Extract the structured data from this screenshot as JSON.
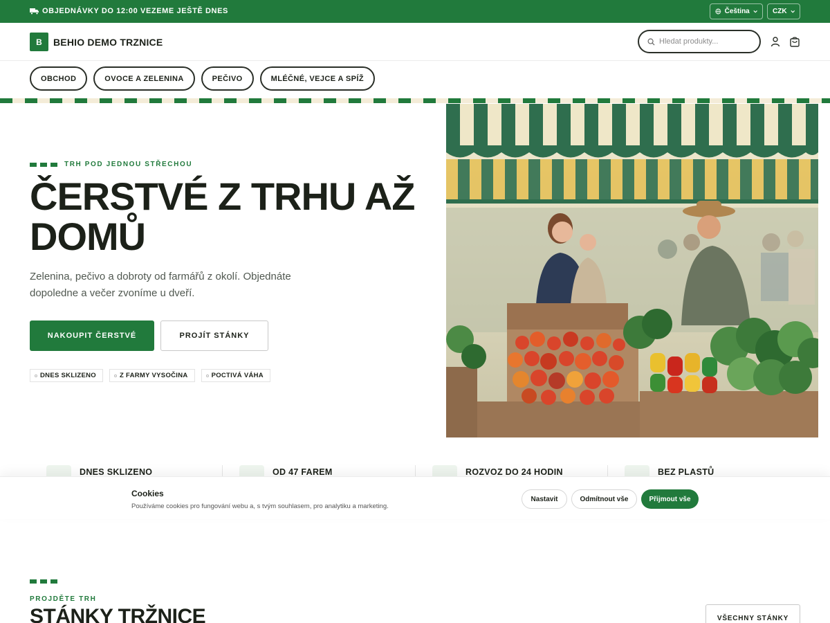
{
  "topbar": {
    "announcement": "OBJEDNÁVKY DO 12:00 VEZEME JEŠTĚ DNES",
    "language": "Čeština",
    "currency": "CZK"
  },
  "header": {
    "logo_letter": "B",
    "site_name": "BEHIO DEMO TRZNICE",
    "search_placeholder": "Hledat produkty..."
  },
  "nav": {
    "items": [
      {
        "label": "OBCHOD"
      },
      {
        "label": "OVOCE A ZELENINA"
      },
      {
        "label": "PEČIVO"
      },
      {
        "label": "MLÉČNÉ, VEJCE A SPÍŽ"
      }
    ]
  },
  "hero": {
    "eyebrow": "TRH POD JEDNOU STŘECHOU",
    "title": "ČERSTVÉ Z TRHU AŽ DOMŮ",
    "subtitle": "Zelenina, pečivo a dobroty od farmářů z okolí. Objednáte dopoledne a večer zvoníme u dveří.",
    "primary_cta": "NAKOUPIT ČERSTVÉ",
    "secondary_cta": "PROJÍT STÁNKY",
    "tags": [
      "DNES SKLIZENO",
      "Z FARMY VYSOČINA",
      "POCTIVÁ VÁHA"
    ]
  },
  "features": [
    {
      "title": "DNES SKLIZENO"
    },
    {
      "title": "OD 47 FAREM"
    },
    {
      "title": "ROZVOZ DO 24 HODIN"
    },
    {
      "title": "BEZ PLASTŮ"
    }
  ],
  "cookie": {
    "title": "Cookies",
    "text": "Používáme cookies pro fungování webu a, s tvým souhlasem, pro analytiku a marketing.",
    "settings": "Nastavit",
    "reject": "Odmítnout vše",
    "accept": "Přijmout vše"
  },
  "stalls": {
    "eyebrow": "PROJDĚTE TRH",
    "title": "STÁNKY TRŽNICE",
    "all_button": "VŠECHNY STÁNKY"
  },
  "colors": {
    "brand_green": "#217a3c",
    "ink": "#1c2119",
    "stripe_cream": "#f4ecd8"
  }
}
